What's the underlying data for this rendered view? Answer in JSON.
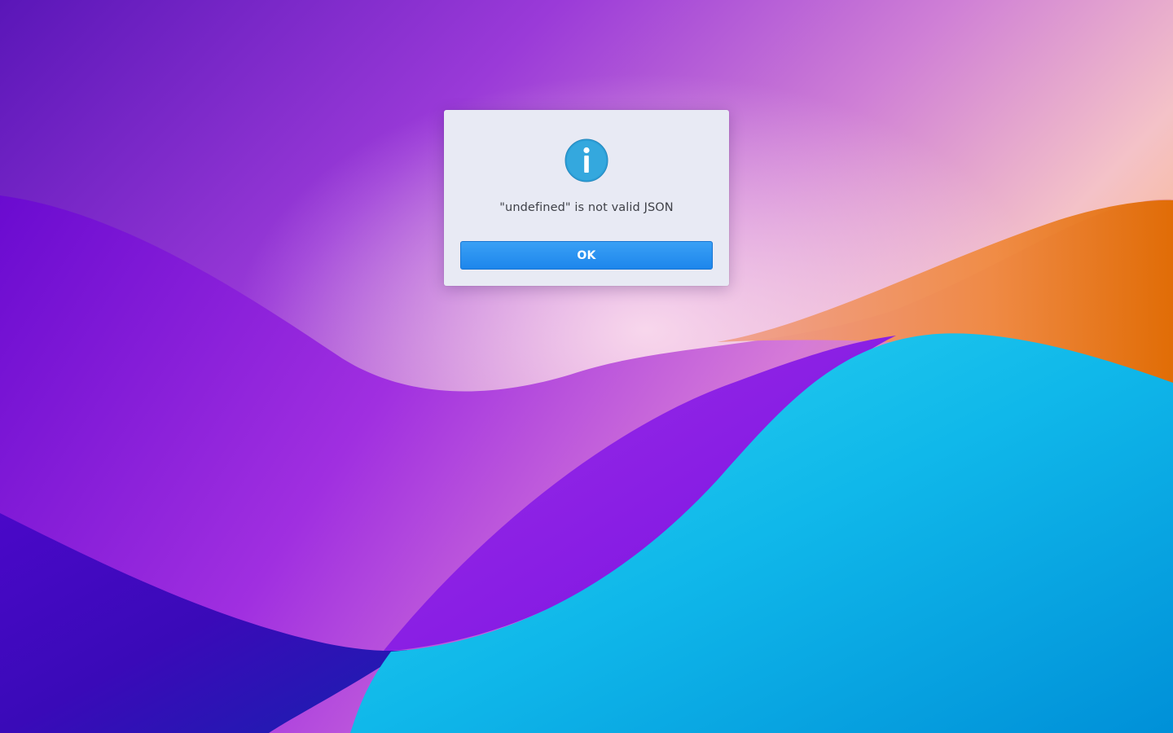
{
  "dialog": {
    "icon": "info-icon",
    "message": "\"undefined\" is not valid JSON",
    "ok_label": "OK"
  },
  "colors": {
    "dialog_background": "#e8eaf4",
    "button_primary": "#1d86ec",
    "info_icon": "#2ea4dc"
  }
}
